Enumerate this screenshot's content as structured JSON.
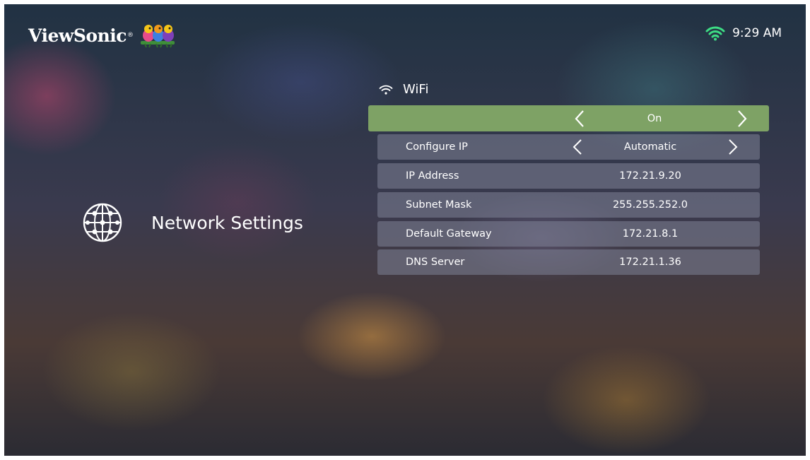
{
  "header": {
    "brand": "ViewSonic",
    "brand_reg": "®",
    "time": "9:29 AM",
    "wifi_status_icon": "wifi-icon"
  },
  "left_panel": {
    "icon": "globe-icon",
    "title": "Network Settings"
  },
  "wifi": {
    "icon": "wifi-icon",
    "title": "WiFi",
    "toggle_value": "On"
  },
  "settings": [
    {
      "label": "Configure IP",
      "value": "Automatic",
      "selectable": true
    },
    {
      "label": "IP Address",
      "value": "172.21.9.20",
      "selectable": false
    },
    {
      "label": "Subnet Mask",
      "value": "255.255.252.0",
      "selectable": false
    },
    {
      "label": "Default Gateway",
      "value": "172.21.8.1",
      "selectable": false
    },
    {
      "label": "DNS Server",
      "value": "172.21.1.36",
      "selectable": false
    }
  ],
  "colors": {
    "accent_green": "#7ea265",
    "wifi_status_green": "#3ddc84",
    "row_background": "#7d8296"
  }
}
